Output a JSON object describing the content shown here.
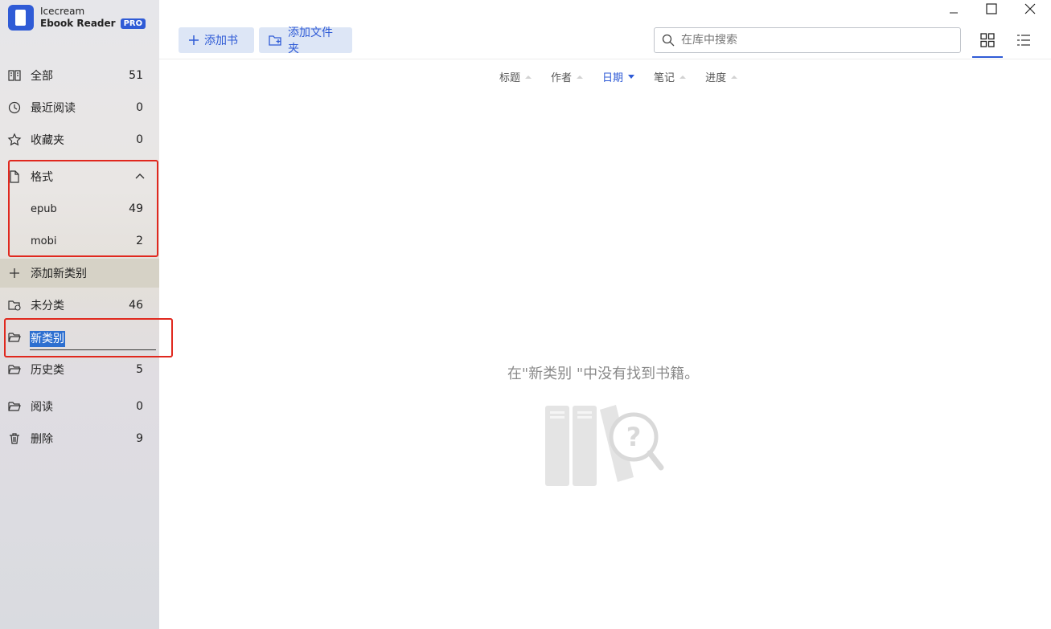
{
  "app": {
    "name_line1": "Icecream",
    "name_line2": "Ebook Reader",
    "badge": "PRO"
  },
  "sidebar": {
    "items": [
      {
        "label": "全部",
        "count": "51",
        "icon": "book-open-icon"
      },
      {
        "label": "最近阅读",
        "count": "0",
        "icon": "history-icon"
      },
      {
        "label": "收藏夹",
        "count": "0",
        "icon": "star-icon"
      }
    ],
    "format": {
      "label": "格式",
      "icon": "file-icon",
      "children": [
        {
          "label": "epub",
          "count": "49"
        },
        {
          "label": "mobi",
          "count": "2"
        }
      ]
    },
    "add_category": "添加新类别",
    "uncategorized": {
      "label": "未分类",
      "count": "46"
    },
    "rename_value": "新类别",
    "categories": [
      {
        "label": "历史类",
        "count": "5"
      },
      {
        "label": "阅读",
        "count": "0"
      }
    ],
    "trash": {
      "label": "删除",
      "count": "9"
    }
  },
  "toolbar": {
    "add_book": "添加书",
    "add_folder": "添加文件夹",
    "search_placeholder": "在库中搜索"
  },
  "sort": {
    "items": [
      "标题",
      "作者",
      "日期",
      "笔记",
      "进度"
    ],
    "active": "日期"
  },
  "main": {
    "empty_message": "在\"新类别 \"中没有找到书籍。"
  },
  "colors": {
    "accent": "#2f5bd6",
    "highlight": "#e0281e"
  }
}
